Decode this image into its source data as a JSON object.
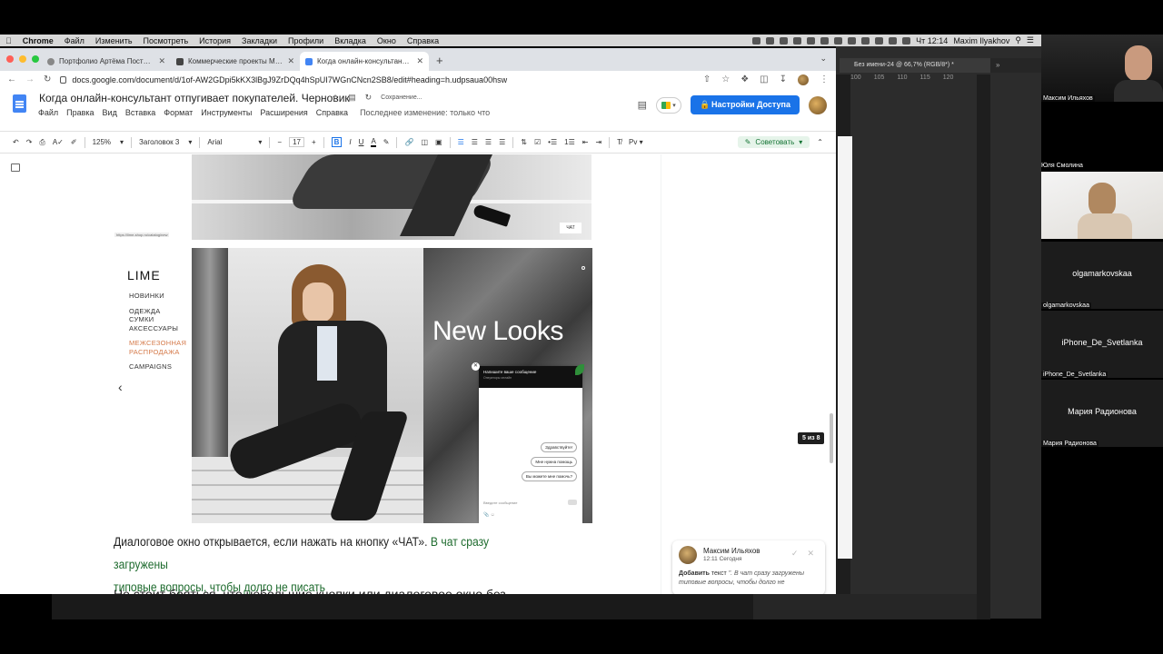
{
  "macbar": {
    "app": "Chrome",
    "menu": [
      "Файл",
      "Изменить",
      "Посмотреть",
      "История",
      "Закладки",
      "Профили",
      "Вкладка",
      "Окно",
      "Справка"
    ],
    "clock": "Чт 12:14",
    "user": "Maxim Ilyakhov"
  },
  "photoshop": {
    "tab_title": "Без имени-24 @ 66,7% (RGB/8*) *",
    "ruler": [
      "100",
      "105",
      "110",
      "115",
      "120"
    ]
  },
  "browser": {
    "tabs": [
      {
        "title": "Портфолио Артёма Постылякова",
        "active": false
      },
      {
        "title": "Коммерческие проекты Максима",
        "active": false
      },
      {
        "title": "Когда онлайн-консультант отпугивает",
        "active": true
      }
    ],
    "url": "docs.google.com/document/d/1of-AW2GDpi5kKX3lBgJ9ZrDQq4hSpUI7WGnCNcn2SB8/edit#heading=h.udpsaua00hsw"
  },
  "docs": {
    "title": "Когда онлайн-консультант отпугивает покупателей. Черновик",
    "saving": "Сохранение...",
    "menu": [
      "Файл",
      "Правка",
      "Вид",
      "Вставка",
      "Формат",
      "Инструменты",
      "Расширения",
      "Справка"
    ],
    "last_edit": "Последнее изменение: только что",
    "share_label": "Настройки Доступа",
    "toolbar": {
      "zoom": "125%",
      "style": "Заголовок 3",
      "font": "Arial",
      "size": "17",
      "mode": "Советовать"
    }
  },
  "screenshot": {
    "chat_button": "ЧАТ",
    "link_text": "https://lime-shop.ru/catalog/new",
    "brand": "LIME",
    "nav": [
      "НОВИНКИ",
      "ОДЕЖДА",
      "СУМКИ",
      "АКСЕССУАРЫ",
      "МЕЖСЕЗОННАЯ",
      "РАСПРОДАЖА",
      "CAMPAIGNS"
    ],
    "banner": "New Looks",
    "chat": {
      "header": "Напишите ваше сообщение",
      "subheader": "Операторы онлайн",
      "bubbles": [
        "Здравствуйте!",
        "Мне нужна помощь",
        "Вы можете мне помочь?"
      ],
      "input_placeholder": "Введите сообщение"
    }
  },
  "body": {
    "p1_plain": "Диалоговое окно открывается, если нажать на кнопку «ЧАТ». ",
    "p1_green_a": "В чат сразу загружены",
    "p1_green_b": "типовые вопросы, чтобы долго не писать",
    "p2": "Не стоит бояться, что небольшие кнопки или диалоговое окно без"
  },
  "page_badge": "5 из 8",
  "comment": {
    "author": "Максим Ильяхов",
    "time": "12:11 Сегодня",
    "action": "Добавить",
    "word": "текст",
    "quote": "\". В чат сразу загружены типовые вопросы, чтобы долго не"
  },
  "zoom": {
    "participants": [
      {
        "name": "Максим Ильяхов",
        "video": true
      },
      {
        "name": "Юля Смолина",
        "video": true
      },
      {
        "name": "olgamarkovskaa",
        "video": false
      },
      {
        "name": "iPhone_De_Svetlanka",
        "video": false
      },
      {
        "name": "Мария Радионова",
        "video": false
      }
    ]
  }
}
